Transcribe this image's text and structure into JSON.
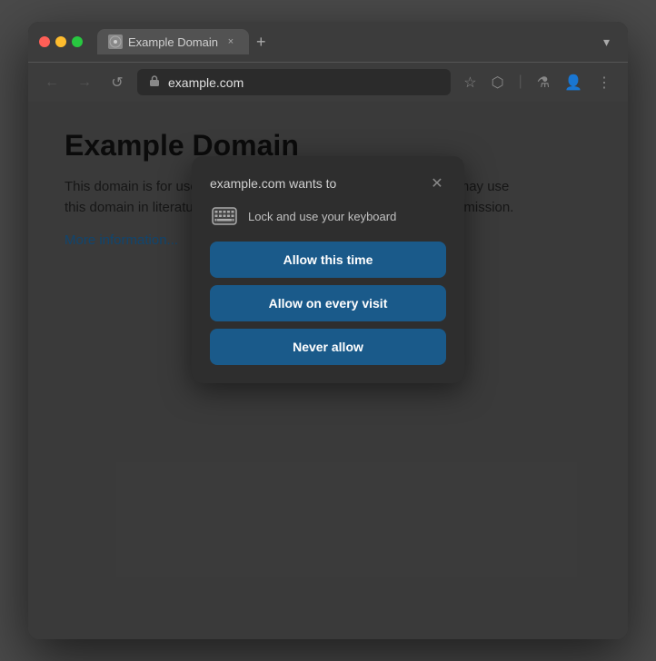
{
  "browser": {
    "traffic_lights": [
      "close",
      "minimize",
      "maximize"
    ],
    "tab": {
      "title": "Example Domain",
      "close_label": "×"
    },
    "tab_add_label": "+",
    "tab_dropdown_label": "▾",
    "nav": {
      "back_label": "←",
      "forward_label": "→",
      "reload_label": "↺"
    },
    "url": "example.com",
    "toolbar": {
      "star_label": "☆",
      "extensions_label": "⬡",
      "divider": "|",
      "flask_label": "⚗",
      "profile_label": "👤",
      "menu_label": "⋮"
    }
  },
  "page": {
    "heading": "Example Domain",
    "body": "This domain is for use in illustrative examples in documents. You may use this domain in literature without prior coordination or asking for permission.",
    "link_text": "More information..."
  },
  "dialog": {
    "title": "example.com wants to",
    "close_label": "✕",
    "permission_text": "Lock and use your keyboard",
    "buttons": [
      {
        "id": "allow-this-time",
        "label": "Allow this time"
      },
      {
        "id": "allow-every-visit",
        "label": "Allow on every visit"
      },
      {
        "id": "never-allow",
        "label": "Never allow"
      }
    ]
  }
}
